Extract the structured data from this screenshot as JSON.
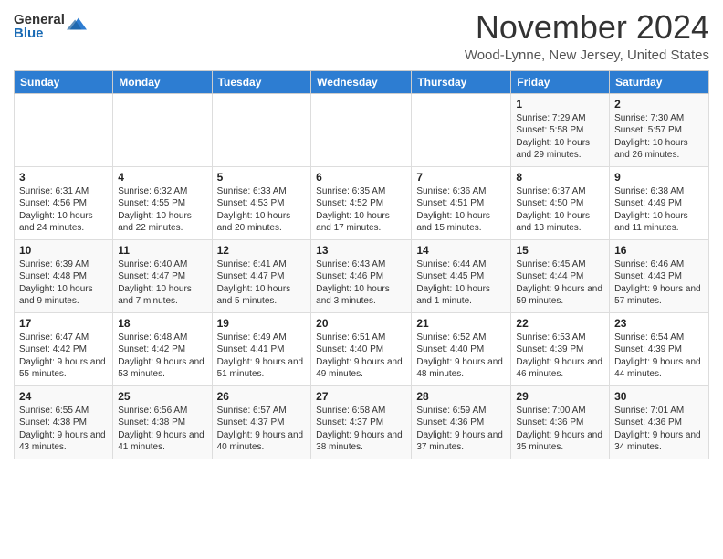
{
  "header": {
    "logo_general": "General",
    "logo_blue": "Blue",
    "month_title": "November 2024",
    "location": "Wood-Lynne, New Jersey, United States"
  },
  "calendar": {
    "days_of_week": [
      "Sunday",
      "Monday",
      "Tuesday",
      "Wednesday",
      "Thursday",
      "Friday",
      "Saturday"
    ],
    "weeks": [
      [
        {
          "day": "",
          "info": ""
        },
        {
          "day": "",
          "info": ""
        },
        {
          "day": "",
          "info": ""
        },
        {
          "day": "",
          "info": ""
        },
        {
          "day": "",
          "info": ""
        },
        {
          "day": "1",
          "info": "Sunrise: 7:29 AM\nSunset: 5:58 PM\nDaylight: 10 hours and 29 minutes."
        },
        {
          "day": "2",
          "info": "Sunrise: 7:30 AM\nSunset: 5:57 PM\nDaylight: 10 hours and 26 minutes."
        }
      ],
      [
        {
          "day": "3",
          "info": "Sunrise: 6:31 AM\nSunset: 4:56 PM\nDaylight: 10 hours and 24 minutes."
        },
        {
          "day": "4",
          "info": "Sunrise: 6:32 AM\nSunset: 4:55 PM\nDaylight: 10 hours and 22 minutes."
        },
        {
          "day": "5",
          "info": "Sunrise: 6:33 AM\nSunset: 4:53 PM\nDaylight: 10 hours and 20 minutes."
        },
        {
          "day": "6",
          "info": "Sunrise: 6:35 AM\nSunset: 4:52 PM\nDaylight: 10 hours and 17 minutes."
        },
        {
          "day": "7",
          "info": "Sunrise: 6:36 AM\nSunset: 4:51 PM\nDaylight: 10 hours and 15 minutes."
        },
        {
          "day": "8",
          "info": "Sunrise: 6:37 AM\nSunset: 4:50 PM\nDaylight: 10 hours and 13 minutes."
        },
        {
          "day": "9",
          "info": "Sunrise: 6:38 AM\nSunset: 4:49 PM\nDaylight: 10 hours and 11 minutes."
        }
      ],
      [
        {
          "day": "10",
          "info": "Sunrise: 6:39 AM\nSunset: 4:48 PM\nDaylight: 10 hours and 9 minutes."
        },
        {
          "day": "11",
          "info": "Sunrise: 6:40 AM\nSunset: 4:47 PM\nDaylight: 10 hours and 7 minutes."
        },
        {
          "day": "12",
          "info": "Sunrise: 6:41 AM\nSunset: 4:47 PM\nDaylight: 10 hours and 5 minutes."
        },
        {
          "day": "13",
          "info": "Sunrise: 6:43 AM\nSunset: 4:46 PM\nDaylight: 10 hours and 3 minutes."
        },
        {
          "day": "14",
          "info": "Sunrise: 6:44 AM\nSunset: 4:45 PM\nDaylight: 10 hours and 1 minute."
        },
        {
          "day": "15",
          "info": "Sunrise: 6:45 AM\nSunset: 4:44 PM\nDaylight: 9 hours and 59 minutes."
        },
        {
          "day": "16",
          "info": "Sunrise: 6:46 AM\nSunset: 4:43 PM\nDaylight: 9 hours and 57 minutes."
        }
      ],
      [
        {
          "day": "17",
          "info": "Sunrise: 6:47 AM\nSunset: 4:42 PM\nDaylight: 9 hours and 55 minutes."
        },
        {
          "day": "18",
          "info": "Sunrise: 6:48 AM\nSunset: 4:42 PM\nDaylight: 9 hours and 53 minutes."
        },
        {
          "day": "19",
          "info": "Sunrise: 6:49 AM\nSunset: 4:41 PM\nDaylight: 9 hours and 51 minutes."
        },
        {
          "day": "20",
          "info": "Sunrise: 6:51 AM\nSunset: 4:40 PM\nDaylight: 9 hours and 49 minutes."
        },
        {
          "day": "21",
          "info": "Sunrise: 6:52 AM\nSunset: 4:40 PM\nDaylight: 9 hours and 48 minutes."
        },
        {
          "day": "22",
          "info": "Sunrise: 6:53 AM\nSunset: 4:39 PM\nDaylight: 9 hours and 46 minutes."
        },
        {
          "day": "23",
          "info": "Sunrise: 6:54 AM\nSunset: 4:39 PM\nDaylight: 9 hours and 44 minutes."
        }
      ],
      [
        {
          "day": "24",
          "info": "Sunrise: 6:55 AM\nSunset: 4:38 PM\nDaylight: 9 hours and 43 minutes."
        },
        {
          "day": "25",
          "info": "Sunrise: 6:56 AM\nSunset: 4:38 PM\nDaylight: 9 hours and 41 minutes."
        },
        {
          "day": "26",
          "info": "Sunrise: 6:57 AM\nSunset: 4:37 PM\nDaylight: 9 hours and 40 minutes."
        },
        {
          "day": "27",
          "info": "Sunrise: 6:58 AM\nSunset: 4:37 PM\nDaylight: 9 hours and 38 minutes."
        },
        {
          "day": "28",
          "info": "Sunrise: 6:59 AM\nSunset: 4:36 PM\nDaylight: 9 hours and 37 minutes."
        },
        {
          "day": "29",
          "info": "Sunrise: 7:00 AM\nSunset: 4:36 PM\nDaylight: 9 hours and 35 minutes."
        },
        {
          "day": "30",
          "info": "Sunrise: 7:01 AM\nSunset: 4:36 PM\nDaylight: 9 hours and 34 minutes."
        }
      ]
    ]
  }
}
